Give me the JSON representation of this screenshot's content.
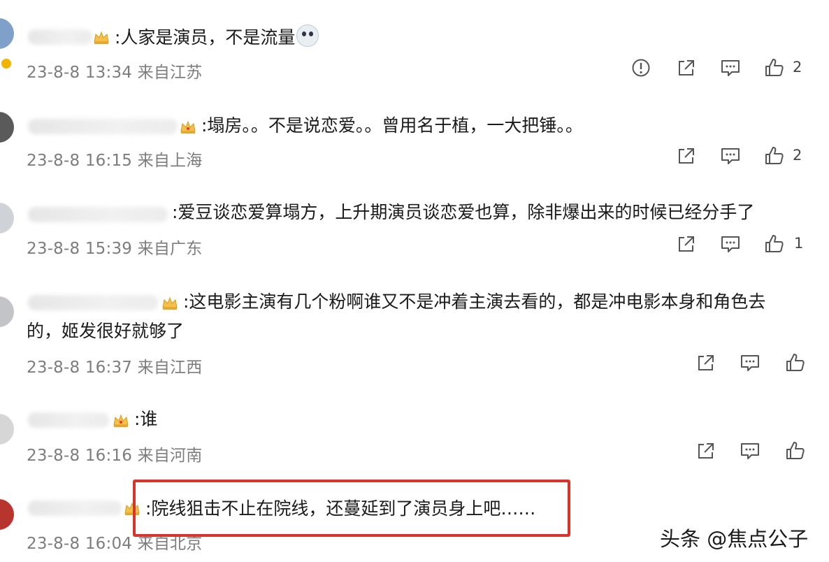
{
  "comments": [
    {
      "text": ":人家是演员，不是流量",
      "emoji": "shocked-face-emoji",
      "time": "23-8-8 13:34 来自江苏",
      "has_report": true,
      "likes": "2"
    },
    {
      "text": ":塌房。。不是说恋爱。。曾用名于植，一大把锤。。",
      "time": "23-8-8 16:15 来自上海",
      "has_report": false,
      "likes": "2"
    },
    {
      "text": ":爱豆谈恋爱算塌方，上升期演员谈恋爱也算，除非爆出来的时候已经分手了",
      "time": "23-8-8 15:39 来自广东",
      "has_report": false,
      "likes": "1"
    },
    {
      "text_line1": ":这电影主演有几个粉啊谁又不是冲着主演去看的，都是冲电影本身和角色去",
      "text_line2": "的，姬发很好就够了",
      "time": "23-8-8 16:37 来自江西",
      "has_report": false,
      "likes": ""
    },
    {
      "text": ":谁",
      "time": "23-8-8 16:16 来自河南",
      "has_report": false,
      "likes": ""
    },
    {
      "text": ":院线狙击不止在院线，还蔓延到了演员身上吧……",
      "time": "23-8-8 16:04 来自北京",
      "has_report": false,
      "likes": ""
    }
  ],
  "watermark": "头条 @焦点公子",
  "colors": {
    "highlight_border": "#d9342b",
    "meta_text": "#7d7d7d",
    "icon_stroke": "#555555"
  },
  "icons": [
    "report-icon",
    "share-icon",
    "comment-icon",
    "like-icon"
  ]
}
